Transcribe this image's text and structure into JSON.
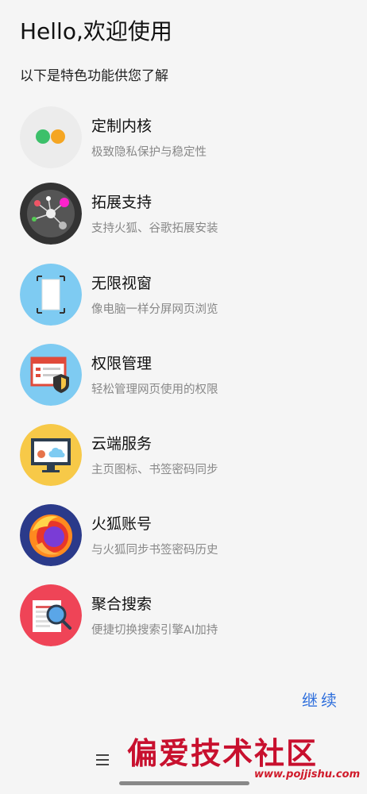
{
  "header": {
    "greeting": "Hello,欢迎使用",
    "subtitle": "以下是特色功能供您了解"
  },
  "features": [
    {
      "title": "定制内核",
      "desc": "极致隐私保护与稳定性",
      "icon": "dual-dot-kernel-icon"
    },
    {
      "title": "拓展支持",
      "desc": "支持火狐、谷歌拓展安装",
      "icon": "extension-network-icon"
    },
    {
      "title": "无限视窗",
      "desc": "像电脑一样分屏网页浏览",
      "icon": "window-frame-icon"
    },
    {
      "title": "权限管理",
      "desc": "轻松管理网页使用的权限",
      "icon": "permission-shield-icon"
    },
    {
      "title": "云端服务",
      "desc": "主页图标、书签密码同步",
      "icon": "cloud-monitor-icon"
    },
    {
      "title": "火狐账号",
      "desc": "与火狐同步书签密码历史",
      "icon": "firefox-icon"
    },
    {
      "title": "聚合搜索",
      "desc": "便捷切换搜索引擎AI加持",
      "icon": "search-magnifier-icon"
    }
  ],
  "actions": {
    "continue_label": "继续"
  },
  "navigation": {
    "menu_icon": "menu-icon"
  },
  "watermark": {
    "title": "偏爱技术社区",
    "url": "www.pojjishu.com"
  },
  "colors": {
    "accent": "#2f6fdc",
    "background": "#f5f5f5",
    "desc_text": "#888888"
  }
}
